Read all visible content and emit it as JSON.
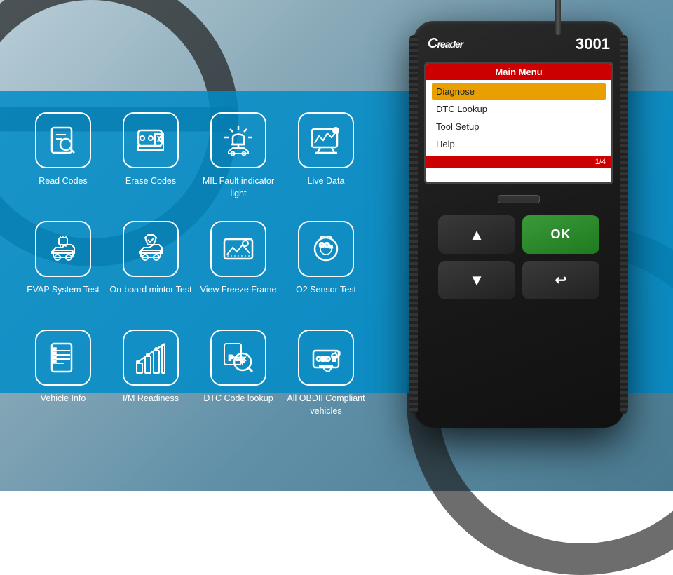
{
  "brand": {
    "logo": "Creader",
    "model": "3001"
  },
  "screen": {
    "header": "Main Menu",
    "menu_items": [
      {
        "label": "Diagnose",
        "active": true
      },
      {
        "label": "DTC Lookup",
        "active": false
      },
      {
        "label": "Tool Setup",
        "active": false
      },
      {
        "label": "Help",
        "active": false
      }
    ],
    "footer": "1/4"
  },
  "buttons": {
    "up": "▲",
    "ok": "OK",
    "down": "▼",
    "back": "↩"
  },
  "features": [
    {
      "id": "read-codes",
      "label": "Read Codes",
      "icon": "read"
    },
    {
      "id": "erase-codes",
      "label": "Erase Codes",
      "icon": "erase"
    },
    {
      "id": "mil-fault",
      "label": "MIL Fault indicator light",
      "icon": "mil"
    },
    {
      "id": "live-data",
      "label": "Live Data",
      "icon": "live"
    },
    {
      "id": "evap",
      "label": "EVAP System Test",
      "icon": "evap"
    },
    {
      "id": "onboard",
      "label": "On-board mintor Test",
      "icon": "onboard"
    },
    {
      "id": "freeze",
      "label": "View Freeze Frame",
      "icon": "freeze"
    },
    {
      "id": "o2",
      "label": "O2 Sensor Test",
      "icon": "o2"
    },
    {
      "id": "vehicle-info",
      "label": "Vehicle Info",
      "icon": "vehicle"
    },
    {
      "id": "im",
      "label": "I/M Readiness",
      "icon": "im"
    },
    {
      "id": "dtc",
      "label": "DTC Code lookup",
      "icon": "dtc"
    },
    {
      "id": "obdii",
      "label": "All OBDII Compliant vehicles",
      "icon": "obdii"
    }
  ],
  "colors": {
    "accent_blue": "#0090c8",
    "screen_red": "#cc0000",
    "ok_green": "#2a8a2a"
  }
}
